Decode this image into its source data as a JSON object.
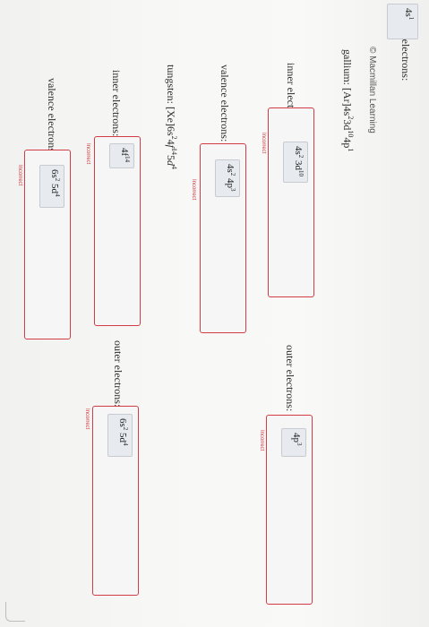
{
  "credit": "© Macmillan Learning",
  "top": {
    "valence_label": "valence electrons:",
    "valence_value": "4s",
    "valence_sup": "1"
  },
  "gallium": {
    "p1": "gallium: [Ar]4s",
    "s1": "2",
    "p2": "3d",
    "s2": "10",
    "p3": "4p",
    "s3": "1",
    "inner_label": "inner electrons:",
    "inner_a": "4s",
    "inner_a_sup": "2",
    "inner_b": " 3d",
    "inner_b_sup": "10",
    "inner_status": "Incorrect",
    "outer_label": "outer electrons:",
    "outer_a": "4p",
    "outer_a_sup": "3",
    "outer_status": "Incorrect",
    "valence_label": "valence electrons:",
    "valence_a": "4s",
    "valence_a_sup": "2",
    "valence_b": " 4p",
    "valence_b_sup": "3",
    "valence_status": "Incorrect"
  },
  "tungsten": {
    "p1": "tungsten: [Xe]6s",
    "s1": "2",
    "p2": "4",
    "p2i": "f",
    "s2": "14",
    "p3": "5",
    "p3i": "d",
    "s3": "4",
    "inner_label": "inner electrons:",
    "inner_a": "4f",
    "inner_a_sup": "14",
    "inner_status": "Incorrect",
    "outer_label": "outer electrons:",
    "outer_a": "6s",
    "outer_a_sup": "2",
    "outer_b": " 5d",
    "outer_b_sup": "4",
    "outer_status": "Incorrect",
    "valence_label": "valence electrons:",
    "valence_a": "6s",
    "valence_a_sup": "2",
    "valence_b": " 5d",
    "valence_b_sup": "4",
    "valence_status": "Incorrect"
  }
}
